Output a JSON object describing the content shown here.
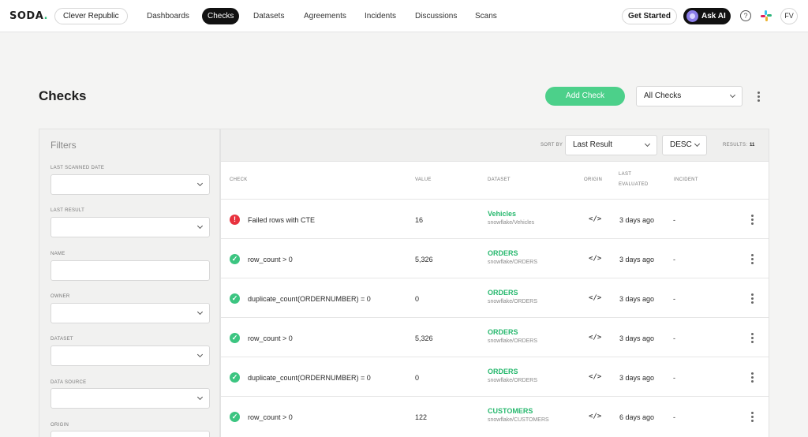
{
  "header": {
    "logo_text": "SODA",
    "logo_dot": ".",
    "organization": "Clever Republic",
    "nav": [
      {
        "label": "Dashboards",
        "active": false
      },
      {
        "label": "Checks",
        "active": true
      },
      {
        "label": "Datasets",
        "active": false
      },
      {
        "label": "Agreements",
        "active": false
      },
      {
        "label": "Incidents",
        "active": false
      },
      {
        "label": "Discussions",
        "active": false
      },
      {
        "label": "Scans",
        "active": false
      }
    ],
    "get_started": "Get Started",
    "ask_ai": "Ask AI",
    "help_icon": "question-circle-icon",
    "slack_icon": "slack-icon",
    "avatar_initials": "FV"
  },
  "page": {
    "title": "Checks",
    "add_check_label": "Add Check",
    "view_select": "All Checks"
  },
  "filters": {
    "title": "Filters",
    "fields": [
      {
        "label": "LAST SCANNED DATE",
        "type": "select",
        "value": ""
      },
      {
        "label": "LAST RESULT",
        "type": "select",
        "value": ""
      },
      {
        "label": "NAME",
        "type": "text",
        "value": ""
      },
      {
        "label": "OWNER",
        "type": "select",
        "value": ""
      },
      {
        "label": "DATASET",
        "type": "select",
        "value": ""
      },
      {
        "label": "DATA SOURCE",
        "type": "select",
        "value": ""
      },
      {
        "label": "ORIGIN",
        "type": "select",
        "value": ""
      }
    ]
  },
  "table": {
    "sort_by_label": "SORT BY",
    "sort_by_value": "Last Result",
    "sort_order": "DESC",
    "results_label": "RESULTS:",
    "results_count": "11",
    "columns": {
      "check": "CHECK",
      "value": "VALUE",
      "dataset": "DATASET",
      "origin": "ORIGIN",
      "last_evaluated_1": "LAST",
      "last_evaluated_2": "EVALUATED",
      "incident": "INCIDENT"
    },
    "rows": [
      {
        "status": "fail",
        "status_glyph": "!",
        "check": "Failed rows with CTE",
        "value": "16",
        "dataset": "Vehicles",
        "dataset_path": "snowflake/Vehicles",
        "origin": "</>",
        "last_evaluated": "3 days ago",
        "incident": "-"
      },
      {
        "status": "pass",
        "status_glyph": "✓",
        "check": "row_count > 0",
        "value": "5,326",
        "dataset": "ORDERS",
        "dataset_path": "snowflake/ORDERS",
        "origin": "</>",
        "last_evaluated": "3 days ago",
        "incident": "-"
      },
      {
        "status": "pass",
        "status_glyph": "✓",
        "check": "duplicate_count(ORDERNUMBER) = 0",
        "value": "0",
        "dataset": "ORDERS",
        "dataset_path": "snowflake/ORDERS",
        "origin": "</>",
        "last_evaluated": "3 days ago",
        "incident": "-"
      },
      {
        "status": "pass",
        "status_glyph": "✓",
        "check": "row_count > 0",
        "value": "5,326",
        "dataset": "ORDERS",
        "dataset_path": "snowflake/ORDERS",
        "origin": "</>",
        "last_evaluated": "3 days ago",
        "incident": "-"
      },
      {
        "status": "pass",
        "status_glyph": "✓",
        "check": "duplicate_count(ORDERNUMBER) = 0",
        "value": "0",
        "dataset": "ORDERS",
        "dataset_path": "snowflake/ORDERS",
        "origin": "</>",
        "last_evaluated": "3 days ago",
        "incident": "-"
      },
      {
        "status": "pass",
        "status_glyph": "✓",
        "check": "row_count > 0",
        "value": "122",
        "dataset": "CUSTOMERS",
        "dataset_path": "snowflake/CUSTOMERS",
        "origin": "</>",
        "last_evaluated": "6 days ago",
        "incident": "-"
      }
    ]
  },
  "colors": {
    "accent_green": "#4cd08a",
    "dataset_green": "#27b86e",
    "fail_red": "#e8323e",
    "pass_green": "#3cc581"
  }
}
